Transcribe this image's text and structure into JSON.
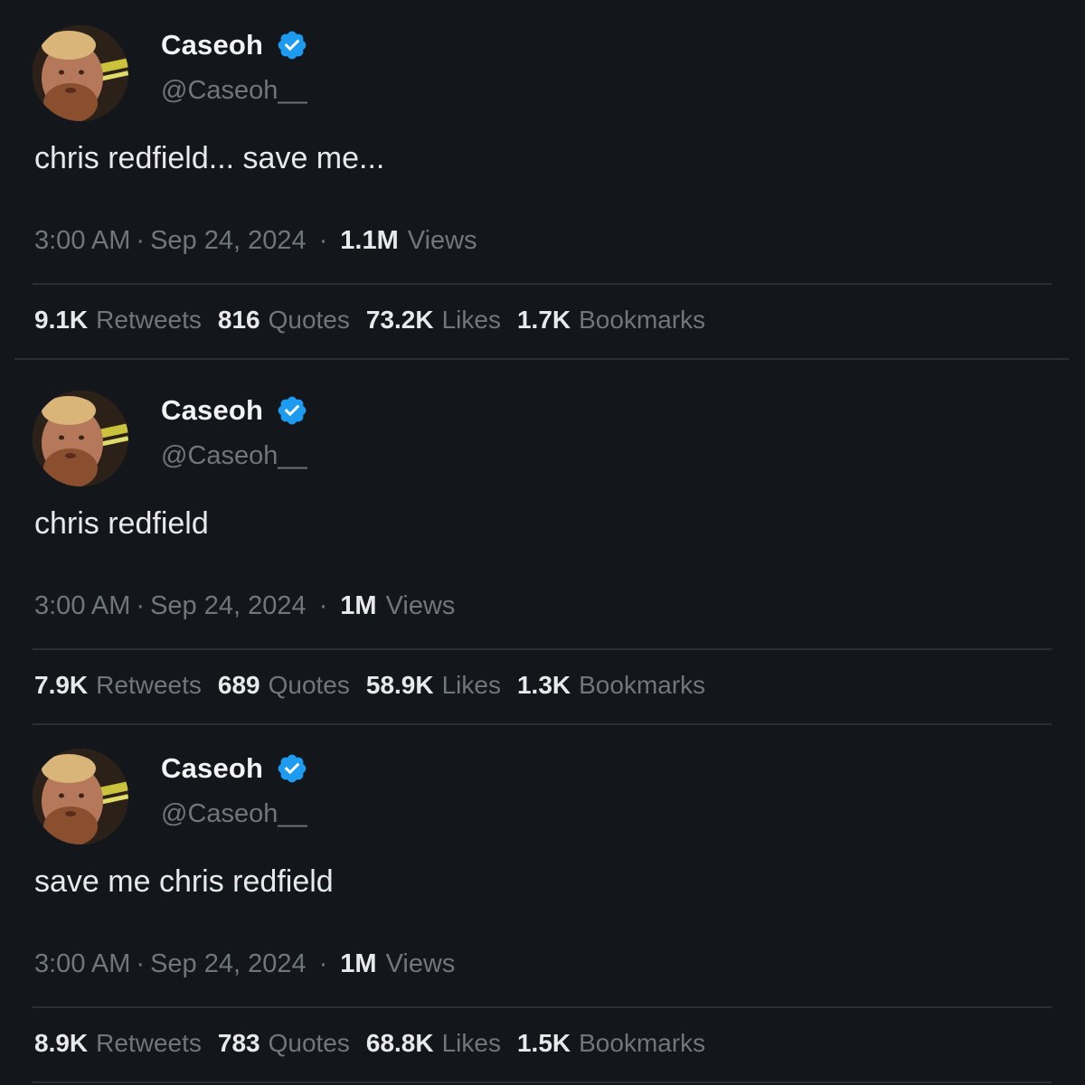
{
  "tweets": [
    {
      "name": "Caseoh",
      "handle": "@Caseoh__",
      "text": "chris redfield... save me...",
      "time": "3:00 AM",
      "date": "Sep 24, 2024",
      "views_count": "1.1M",
      "views_label": "Views",
      "retweets_count": "9.1K",
      "retweets_label": "Retweets",
      "quotes_count": "816",
      "quotes_label": "Quotes",
      "likes_count": "73.2K",
      "likes_label": "Likes",
      "bookmarks_count": "1.7K",
      "bookmarks_label": "Bookmarks"
    },
    {
      "name": "Caseoh",
      "handle": "@Caseoh__",
      "text": "chris redfield",
      "time": "3:00 AM",
      "date": "Sep 24, 2024",
      "views_count": "1M",
      "views_label": "Views",
      "retweets_count": "7.9K",
      "retweets_label": "Retweets",
      "quotes_count": "689",
      "quotes_label": "Quotes",
      "likes_count": "58.9K",
      "likes_label": "Likes",
      "bookmarks_count": "1.3K",
      "bookmarks_label": "Bookmarks"
    },
    {
      "name": "Caseoh",
      "handle": "@Caseoh__",
      "text": "save me chris redfield",
      "time": "3:00 AM",
      "date": "Sep 24, 2024",
      "views_count": "1M",
      "views_label": "Views",
      "retweets_count": "8.9K",
      "retweets_label": "Retweets",
      "quotes_count": "783",
      "quotes_label": "Quotes",
      "likes_count": "68.8K",
      "likes_label": "Likes",
      "bookmarks_count": "1.5K",
      "bookmarks_label": "Bookmarks"
    }
  ],
  "colors": {
    "background": "#13161b",
    "primary_text": "#e7e9ea",
    "secondary_text": "#71767b",
    "verified_badge": "#1d9bf0",
    "divider": "#2a2f35"
  },
  "icons": {
    "verified": "verified-badge-icon"
  }
}
